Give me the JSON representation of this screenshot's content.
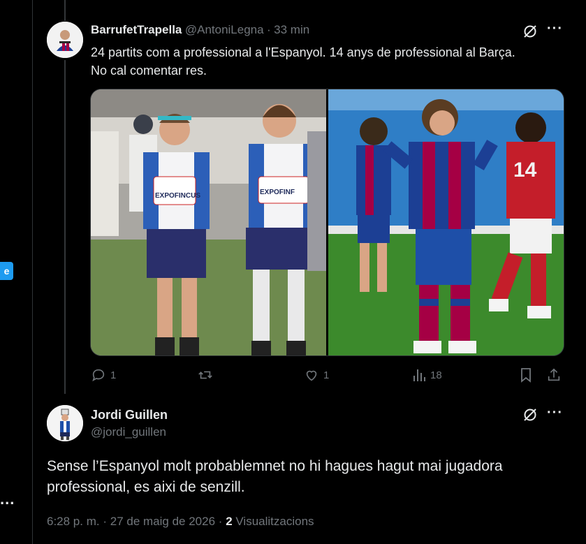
{
  "left_rail": {
    "chip_label": "e",
    "more_label": "..."
  },
  "tweet": {
    "display_name": "BarrufetTrapella",
    "handle": "@AntoniLegna",
    "separator": "·",
    "time": "33 min",
    "text_line1": "24 partits com a professional a l'Espanyol. 14 anys de professional al Barça.",
    "text_line2": "No cal comentar res.",
    "media_left_sponsor_1": "EXPOFINCUS",
    "media_left_sponsor_2": "EXPOFINF",
    "media_right_shirt_number": "14",
    "actions": {
      "reply_count": "1",
      "retweet_count": "",
      "like_count": "1",
      "views_count": "18"
    },
    "more_label": "···"
  },
  "reply": {
    "display_name": "Jordi Guillen",
    "handle": "@jordi_guillen",
    "text_line1": "Sense l’Espanyol molt probablemnet no hi hagues hagut mai jugadora",
    "text_line2": "professional, es aixi de senzill.",
    "time": "6:28 p. m.",
    "separator": "·",
    "date": "27 de maig de 2026",
    "separator2": "·",
    "views_count": "2",
    "views_label": "Visualitzacions",
    "more_label": "···"
  },
  "icons": {
    "grok": "grok-icon",
    "more": "more-icon",
    "reply": "reply-icon",
    "retweet": "retweet-icon",
    "like": "heart-icon",
    "views": "views-icon",
    "bookmark": "bookmark-icon",
    "share": "share-icon"
  },
  "colors": {
    "background": "#000000",
    "text": "#e7e9ea",
    "muted": "#71767b",
    "border": "#2f3336",
    "accent": "#1d9bf0",
    "espanyol_blue": "#1e4fa8",
    "barca_blue": "#1c3f94",
    "barca_red": "#a50044"
  }
}
